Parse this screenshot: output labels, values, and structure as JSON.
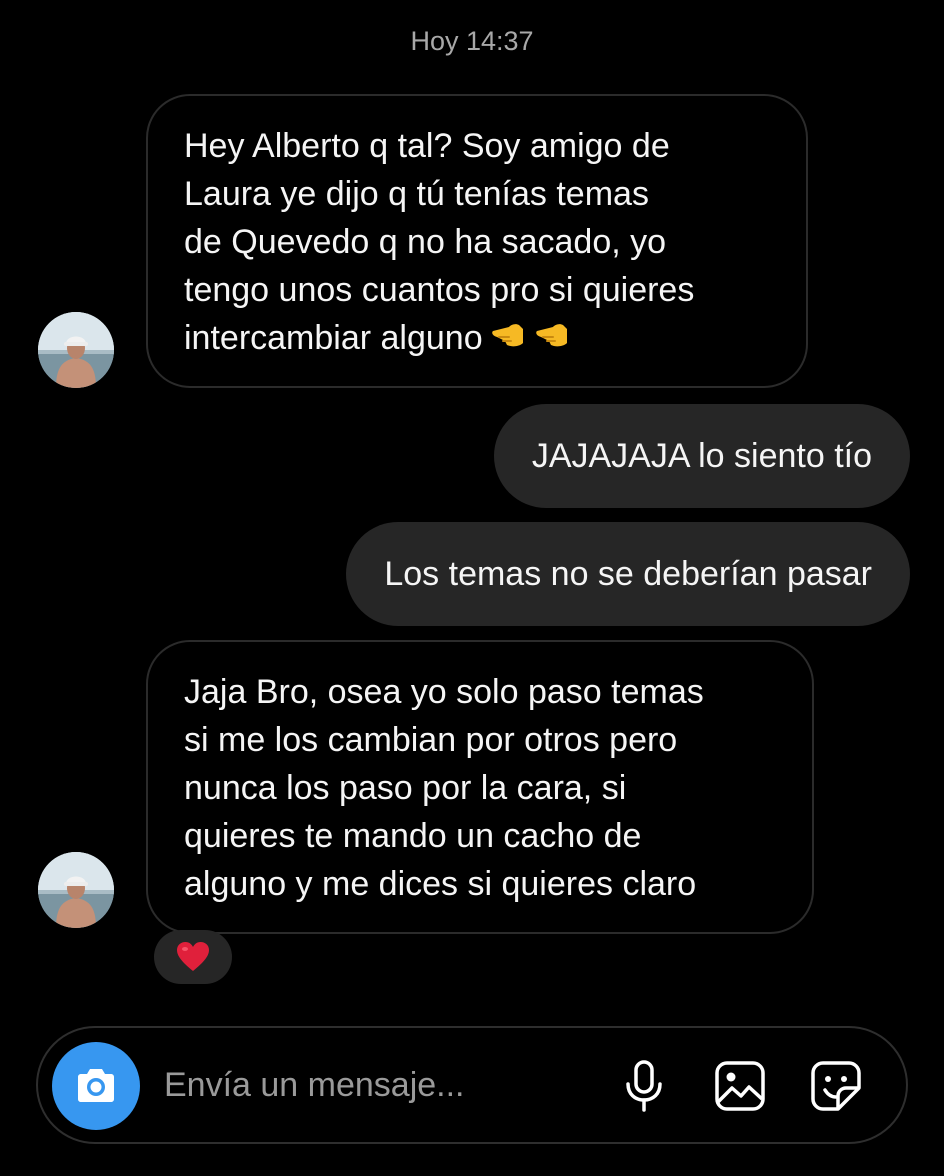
{
  "header": {
    "timestamp": "Hoy 14:37"
  },
  "messages": [
    {
      "direction": "received",
      "text": "Hey Alberto q tal? Soy amigo de\nLaura ye dijo q tú tenías temas\nde Quevedo q no ha sacado, yo\ntengo unos cuantos pro si quieres\nintercambiar alguno",
      "emoji_icons": [
        "backhand-index-pointing-left-icon",
        "backhand-index-pointing-left-icon"
      ]
    },
    {
      "direction": "sent",
      "text": "JAJAJAJA lo siento tío"
    },
    {
      "direction": "sent",
      "text": "Los temas no se deberían pasar"
    },
    {
      "direction": "received",
      "text": "Jaja Bro, osea yo solo paso temas\nsi me los cambian por otros pero\nnunca los paso por la cara, si\nquieres te mando un cacho de\nalguno y me dices si quieres claro",
      "reaction_icon": "red-heart-icon"
    }
  ],
  "composer": {
    "placeholder": "Envía un mensaje...",
    "icons": [
      "camera-icon",
      "microphone-icon",
      "gallery-icon",
      "sticker-icon"
    ]
  },
  "colors": {
    "background": "#000000",
    "sent_bubble": "#262626",
    "received_border": "#2b2b2b",
    "camera_button": "#3797f0",
    "timestamp_text": "#a8a8a8",
    "placeholder_text": "#9a9a9a",
    "heart": "#e0203b",
    "hand_emoji": "#f6b924"
  }
}
